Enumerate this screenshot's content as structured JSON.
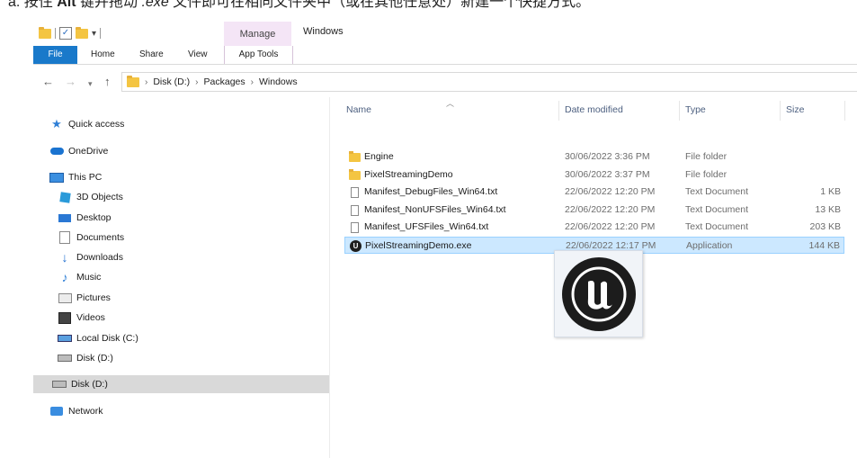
{
  "caption": {
    "prefix": "a. 按住 ",
    "key": "Alt",
    "middle": " 键并拖动 ",
    "ext": ".exe",
    "suffix": " 文件即可在相同文件夹中（或在其他任意处）新建一个快捷方式。"
  },
  "titlebar": {
    "quick_access_dropdown": "▾",
    "manage_tab": "Manage",
    "window_title": "Windows"
  },
  "ribbon": {
    "tabs": [
      "File",
      "Home",
      "Share",
      "View",
      "App Tools"
    ]
  },
  "address_bar": {
    "breadcrumbs": [
      "Disk (D:)",
      "Packages",
      "Windows"
    ]
  },
  "nav_pane": {
    "items": [
      {
        "label": "Quick access",
        "icon": "star-icon"
      },
      {
        "label": "OneDrive",
        "icon": "cloud-icon"
      },
      {
        "label": "This PC",
        "icon": "computer-icon"
      },
      {
        "label": "3D Objects",
        "icon": "cube-icon"
      },
      {
        "label": "Desktop",
        "icon": "desktop-icon"
      },
      {
        "label": "Documents",
        "icon": "document-icon"
      },
      {
        "label": "Downloads",
        "icon": "download-icon"
      },
      {
        "label": "Music",
        "icon": "music-icon"
      },
      {
        "label": "Pictures",
        "icon": "picture-icon"
      },
      {
        "label": "Videos",
        "icon": "video-icon"
      },
      {
        "label": "Local Disk (C:)",
        "icon": "drive-icon"
      },
      {
        "label": "Disk (D:)",
        "icon": "drive-icon"
      },
      {
        "label": "Disk (D:)",
        "icon": "drive-icon",
        "selected": true
      },
      {
        "label": "Network",
        "icon": "network-icon"
      }
    ]
  },
  "file_list": {
    "columns": [
      "Name",
      "Date modified",
      "Type",
      "Size"
    ],
    "rows": [
      {
        "name": "Engine",
        "date": "30/06/2022 3:36 PM",
        "type": "File folder",
        "size": "",
        "icon": "folder-icon"
      },
      {
        "name": "PixelStreamingDemo",
        "date": "30/06/2022 3:37 PM",
        "type": "File folder",
        "size": "",
        "icon": "folder-icon"
      },
      {
        "name": "Manifest_DebugFiles_Win64.txt",
        "date": "22/06/2022 12:20 PM",
        "type": "Text Document",
        "size": "1 KB",
        "icon": "text-file-icon"
      },
      {
        "name": "Manifest_NonUFSFiles_Win64.txt",
        "date": "22/06/2022 12:20 PM",
        "type": "Text Document",
        "size": "13 KB",
        "icon": "text-file-icon"
      },
      {
        "name": "Manifest_UFSFiles_Win64.txt",
        "date": "22/06/2022 12:20 PM",
        "type": "Text Document",
        "size": "203 KB",
        "icon": "text-file-icon"
      },
      {
        "name": "PixelStreamingDemo.exe",
        "date": "22/06/2022 12:17 PM",
        "type": "Application",
        "size": "144 KB",
        "icon": "unreal-app-icon",
        "selected": true
      }
    ]
  },
  "colors": {
    "file_tab": "#1979ca",
    "manage_tab": "#f4e5f6",
    "selection": "#cce8ff",
    "nav_selected": "#d9d9d9"
  }
}
